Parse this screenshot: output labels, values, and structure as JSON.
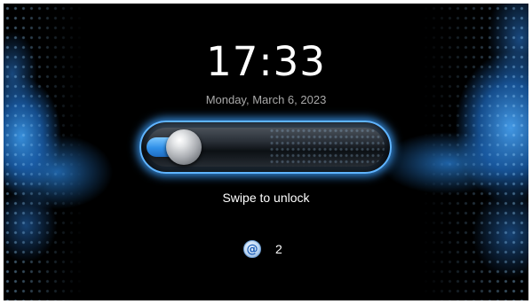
{
  "lockscreen": {
    "time": "17:33",
    "date": "Monday, March  6, 2023",
    "unlock_hint": "Swipe to unlock",
    "slider": {
      "progress": 0
    },
    "notifications": [
      {
        "icon": "email-icon",
        "glyph": "@",
        "count": "2"
      }
    ]
  },
  "colors": {
    "background": "#000000",
    "accent": "#3a96e6",
    "slider_glow": "#5fb4ff",
    "clock_text": "#ffffff",
    "date_text": "#a9a9a9"
  }
}
